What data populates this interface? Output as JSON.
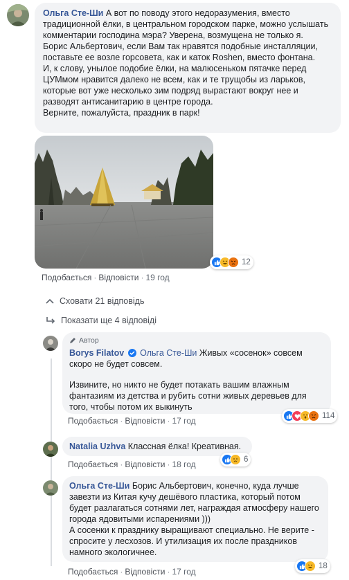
{
  "comments": [
    {
      "author": "Ольга Сте-Ши",
      "paragraphs": [
        "А вот по поводу этого недоразумения, вместо традиционной ёлки, в центральном городском парке, можно услышать комментарии господина мэра? Уверена, возмущена не только я.",
        "Борис Альбертович, если Вам так нравятся подобные инсталляции, поставьте ее возле горсовета, как и каток Roshen, вместо фонтана.",
        "И, к слову, унылое подобие ёлки, на малюсеньком пятачке перед ЦУМмом нравится далеко не всем, как и те трущобы из ларьков, которые вот уже несколько зим подряд вырастают вокруг нее и разводят антисанитарию в центре города.",
        "Верните, пожалуйста, праздник в парк!"
      ],
      "like": "Подобається",
      "reply": "Відповісти",
      "time": "19 год",
      "reactions": {
        "count": "12",
        "icons": [
          "like-icon",
          "haha-icon",
          "angry-icon"
        ]
      }
    },
    {
      "badge": "Автор",
      "author": "Borys Filatov",
      "mention": "Ольга Сте-Ши",
      "line1": "Живых «сосенок» совсем скоро не будет совсем.",
      "line2": "Извините, но никто не будет потакать вашим влажным фантазиям из детства и рубить сотни живых деревьев для того, чтобы потом их выкинуть",
      "like": "Подобається",
      "reply": "Відповісти",
      "time": "17 год",
      "reactions": {
        "count": "114",
        "icons": [
          "like-icon",
          "love-icon",
          "wow-icon",
          "angry-icon"
        ]
      }
    },
    {
      "author": "Natalia Uzhva",
      "text": "Классная ёлка! Креативная.",
      "like": "Подобається",
      "reply": "Відповісти",
      "time": "18 год",
      "reactions": {
        "count": "6",
        "icons": [
          "like-icon",
          "sad-icon"
        ]
      }
    },
    {
      "author": "Ольга Сте-Ши",
      "text": "Борис Альбертович, конечно, куда лучше завезти из Китая кучу дешёвого пластика, который потом будет разлагаться сотнями лет, награждая атмосферу нашего города ядовитыми испарениями )))",
      "text2": "А сосенки к празднику выращивают специально. Не верите - спросите у лесхозов. И утилизация их после праздников намного экологичнее.",
      "like": "Подобається",
      "reply": "Відповісти",
      "time": "17 год",
      "reactions": {
        "count": "18",
        "icons": [
          "like-icon",
          "haha-icon"
        ]
      }
    }
  ],
  "hide_replies": "Сховати 21 відповідь",
  "show_more": "Показати ще 4 відповіді",
  "colors": {
    "link": "#385898",
    "bubble": "#f2f3f5",
    "like": "#1877f2"
  }
}
